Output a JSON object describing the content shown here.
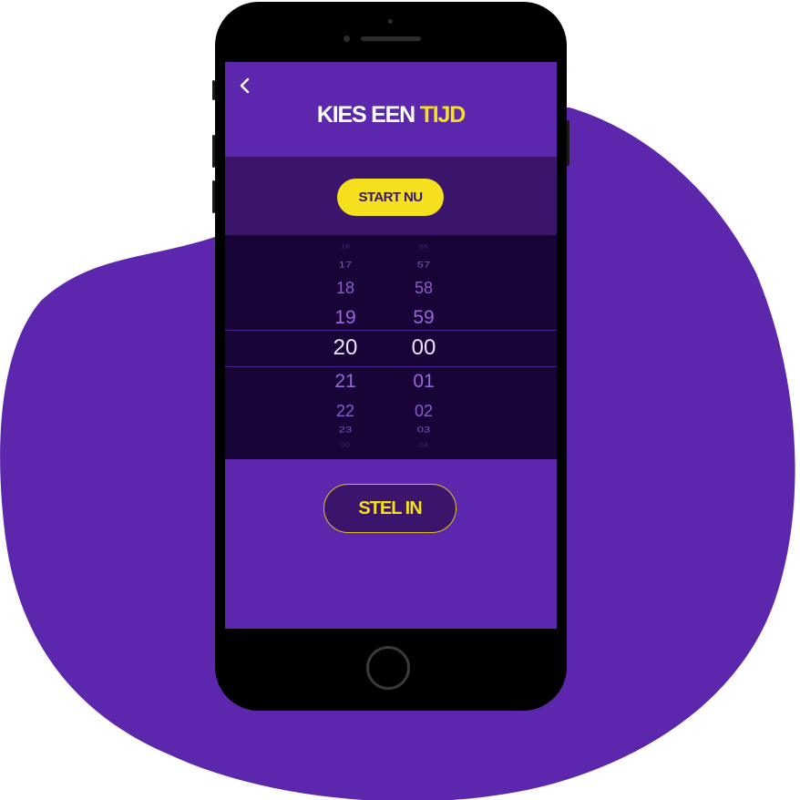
{
  "colors": {
    "blob": "#5c27ad",
    "screen_bg": "#5c27ad",
    "band_bg": "#3a156b",
    "picker_bg": "#180437",
    "accent_yellow": "#f4e01c",
    "picker_selected_text": "#ece4ff",
    "picker_text": "#9a66e0"
  },
  "header": {
    "back_icon": "chevron-left-icon",
    "title_main": "KIES EEN ",
    "title_accent": "TIJD"
  },
  "start_button": {
    "label": "START NU"
  },
  "picker": {
    "hours": [
      "16",
      "17",
      "18",
      "19",
      "20",
      "21",
      "22",
      "23",
      "00"
    ],
    "minutes": [
      "56",
      "57",
      "58",
      "59",
      "00",
      "01",
      "02",
      "03",
      "04"
    ],
    "selected_hour": "20",
    "selected_minute": "00"
  },
  "confirm_button": {
    "label": "STEL IN"
  }
}
